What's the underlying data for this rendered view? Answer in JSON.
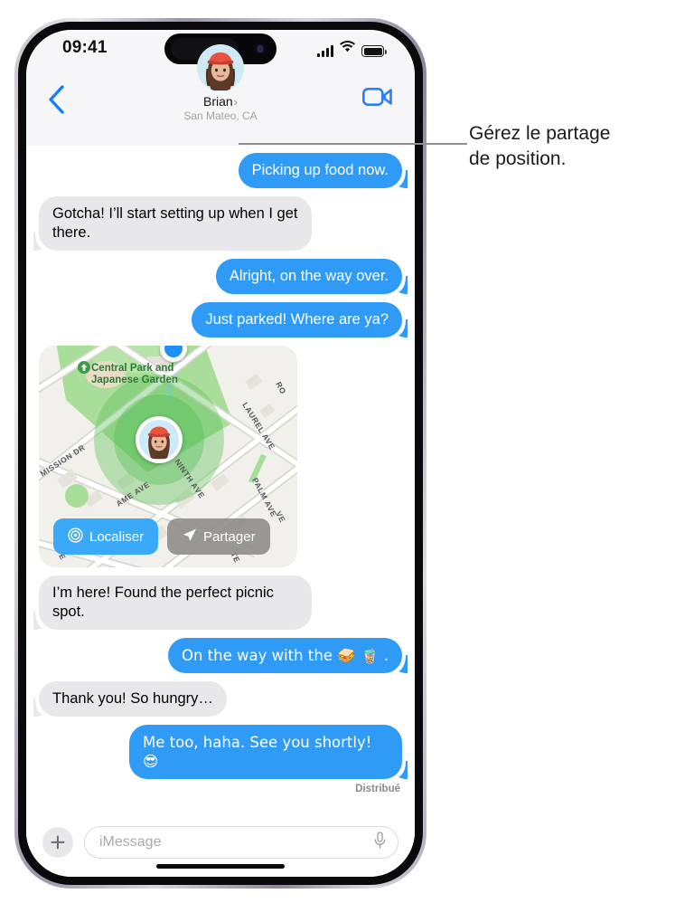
{
  "status_bar": {
    "time": "09:41",
    "signal_icon": "cellular-bars-icon",
    "wifi_icon": "wifi-icon",
    "battery_icon": "battery-full-icon"
  },
  "nav": {
    "back_icon": "chevron-left-icon",
    "facetime_icon": "video-camera-icon",
    "contact_name": "Brian",
    "contact_chevron": "›",
    "contact_location": "San Mateo, CA",
    "avatar_icon": "memoji-avatar"
  },
  "messages": [
    {
      "side": "out",
      "text": "Picking up food now."
    },
    {
      "side": "in",
      "text": "Gotcha! I’ll start setting up when I get there."
    },
    {
      "side": "out",
      "text": "Alright, on the way over."
    },
    {
      "side": "out",
      "text": "Just parked! Where are ya?"
    },
    {
      "side": "map"
    },
    {
      "side": "in",
      "text": "I’m here! Found the perfect picnic spot."
    },
    {
      "side": "out",
      "text": "On the way with the 🥪 🧋 ."
    },
    {
      "side": "in",
      "text": "Thank you! So hungry…"
    },
    {
      "side": "out",
      "text": "Me too, haha. See you shortly! 😎"
    }
  ],
  "delivery_status": "Distribué",
  "map": {
    "park_label_line1": "Central Park and",
    "park_label_line2": "Japanese Garden",
    "park_icon": "park-marker-icon",
    "streets": [
      "MISSION DR",
      "NINTH AVE",
      "LAUREL AVE",
      "PALM AVE",
      "AME AVE",
      "RO",
      "TE",
      "VE",
      "E"
    ],
    "locate_button": {
      "label": "Localiser",
      "icon": "radar-icon",
      "color": "#3aa9f7"
    },
    "share_button": {
      "label": "Partager",
      "icon": "send-arrow-icon",
      "color": "#8c8a86"
    },
    "pin_icon": "memoji-location-pin",
    "other_pin_icon": "blue-dot-pin"
  },
  "input_bar": {
    "plus_icon": "plus-icon",
    "placeholder": "iMessage",
    "mic_icon": "microphone-icon"
  },
  "callout": {
    "line1": "Gérez le partage",
    "line2": "de position."
  },
  "colors": {
    "outgoing_bubble": "#2f9bf6",
    "incoming_bubble": "#e8e8ea",
    "accent_blue": "#007aff",
    "header_bg": "#f6f5f7"
  }
}
